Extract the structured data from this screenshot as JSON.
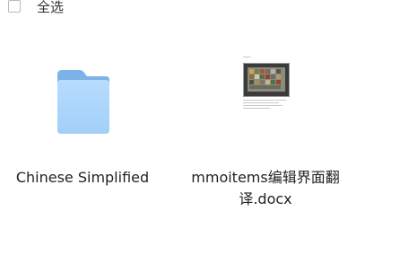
{
  "toolbar": {
    "select_all_label": "全选"
  },
  "files": [
    {
      "name": "Chinese Simplified",
      "type": "folder",
      "icon": "folder-icon"
    },
    {
      "name": "mmoitems编辑界面翻译.docx",
      "type": "docx",
      "icon": "document-thumbnail"
    }
  ],
  "colors": {
    "folder_front": "#a9d4fb",
    "folder_back": "#7fb5e8",
    "checkbox_border": "#b9b9b9"
  }
}
